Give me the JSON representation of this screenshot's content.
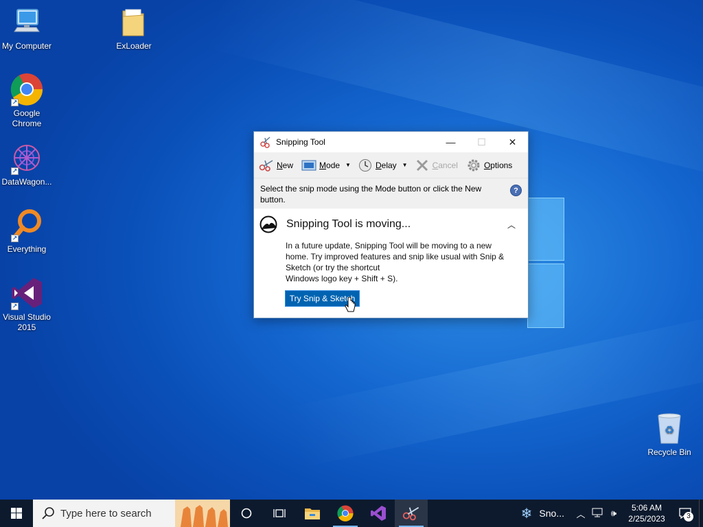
{
  "desktop": {
    "icons": [
      {
        "label": "My Computer",
        "icon": "computer-icon"
      },
      {
        "label": "ExLoader",
        "icon": "folder-icon"
      },
      {
        "label": "Google\nChrome",
        "icon": "chrome-icon"
      },
      {
        "label": "DataWagon...",
        "icon": "datawagon-icon"
      },
      {
        "label": "Everything",
        "icon": "everything-search-icon"
      },
      {
        "label": "Visual Studio\n2015",
        "icon": "visual-studio-icon"
      },
      {
        "label": "Recycle Bin",
        "icon": "recycle-bin-icon"
      }
    ]
  },
  "window": {
    "title": "Snipping Tool",
    "controls": {
      "minimize": "—",
      "maximize": "☐",
      "close": "✕"
    },
    "toolbar": {
      "new": {
        "prefix": "",
        "mnemonic": "N",
        "rest": "ew"
      },
      "mode": {
        "mnemonic": "M",
        "rest": "ode"
      },
      "delay": {
        "mnemonic": "D",
        "rest": "elay"
      },
      "cancel": {
        "mnemonic": "C",
        "rest": "ancel"
      },
      "options": {
        "mnemonic": "O",
        "rest": "ptions"
      }
    },
    "info_text": "Select the snip mode using the Mode button or click the New button.",
    "help_label": "?",
    "moving": {
      "title": "Snipping Tool is moving...",
      "body": "In a future update, Snipping Tool will be moving to a new home. Try improved features and snip like usual with Snip & Sketch (or try the shortcut",
      "body2": "Windows logo key + Shift + S).",
      "button": "Try Snip & Sketch"
    }
  },
  "taskbar": {
    "search_placeholder": "Type here to search",
    "weather_label": "Sno...",
    "time": "5:06 AM",
    "date": "2/25/2023",
    "notification_count": "3"
  },
  "colors": {
    "desktop_blue": "#1466cf",
    "taskbar": "#0d1a2e",
    "accent": "#0063b1"
  }
}
